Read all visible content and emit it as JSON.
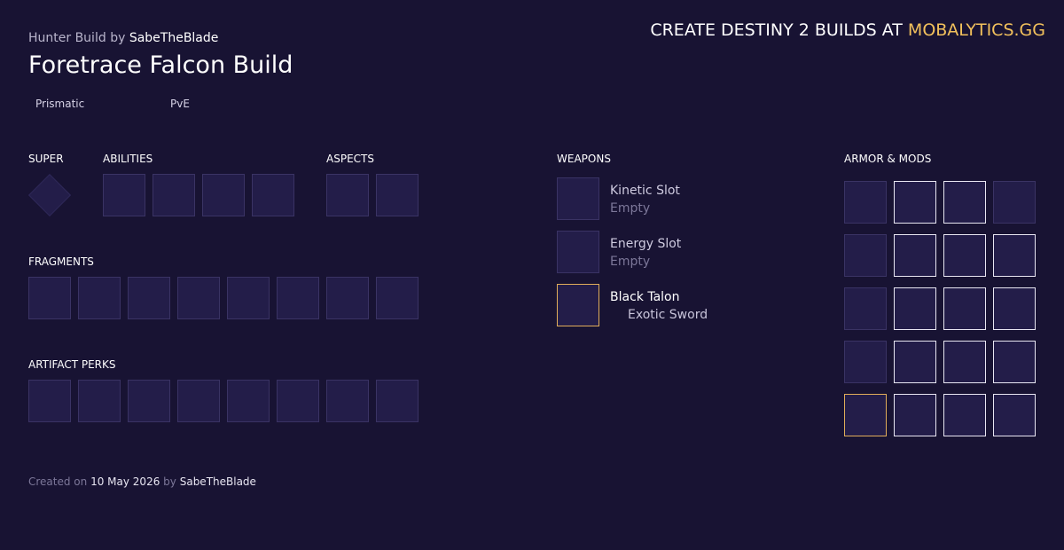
{
  "header": {
    "build_type_prefix": "Hunter Build",
    "by_word": "by",
    "author": "SabeTheBlade",
    "title": "Foretrace Falcon Build",
    "tags": [
      "Prismatic",
      "PvE"
    ]
  },
  "promo": {
    "text": "CREATE DESTINY 2 BUILDS AT",
    "brand": "MOBALYTICS.GG",
    "brand_color": "#f2c15c"
  },
  "sections": {
    "super": "SUPER",
    "abilities": "ABILITIES",
    "aspects": "ASPECTS",
    "fragments": "FRAGMENTS",
    "artifact_perks": "ARTIFACT PERKS",
    "weapons": "WEAPONS",
    "armor_mods": "ARMOR & MODS"
  },
  "weapons": [
    {
      "name": "Kinetic Slot",
      "sub": "Empty",
      "exotic": false
    },
    {
      "name": "Energy Slot",
      "sub": "Empty",
      "exotic": false
    },
    {
      "name": "Black Talon",
      "sub": "Exotic Sword",
      "exotic": true
    }
  ],
  "footer": {
    "created_on": "Created on",
    "date": "10 May 2026",
    "by_word": "by",
    "author": "SabeTheBlade"
  },
  "colors": {
    "background": "#181333",
    "slot_fill": "#231d49",
    "exotic_border": "#e0ad5a"
  }
}
